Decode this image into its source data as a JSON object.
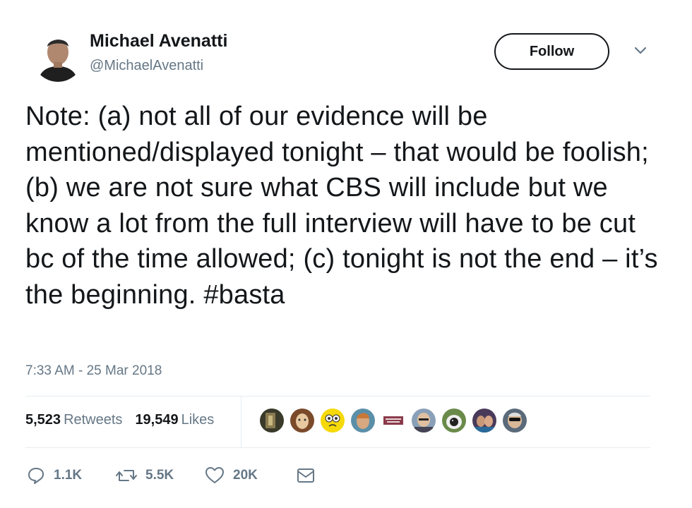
{
  "user": {
    "display_name": "Michael Avenatti",
    "handle": "@MichaelAvenatti",
    "avatar_icon": "person-avatar"
  },
  "follow_button": {
    "label": "Follow"
  },
  "menu_caret": {
    "icon": "chevron-down-icon"
  },
  "tweet": {
    "text": "Note: (a) not all of our evidence will be mentioned/displayed tonight – that would be foolish; (b) we are not sure what CBS will include but we know a lot from the full interview will have to be cut bc of the time allowed; (c) tonight is not the end – it’s the beginning. #basta",
    "timestamp": "7:33 AM - 25 Mar 2018"
  },
  "stats": {
    "retweets_count": "5,523",
    "retweets_label": "Retweets",
    "likes_count": "19,549",
    "likes_label": "Likes"
  },
  "liker_faces": [
    "face-1",
    "face-2",
    "face-3",
    "face-4",
    "face-5",
    "face-6",
    "face-7",
    "face-8",
    "face-9"
  ],
  "actions": {
    "reply_count": "1.1K",
    "retweet_count": "5.5K",
    "like_count": "20K"
  },
  "colors": {
    "text": "#14171a",
    "secondary": "#657786",
    "divider": "#e6ecf0"
  }
}
